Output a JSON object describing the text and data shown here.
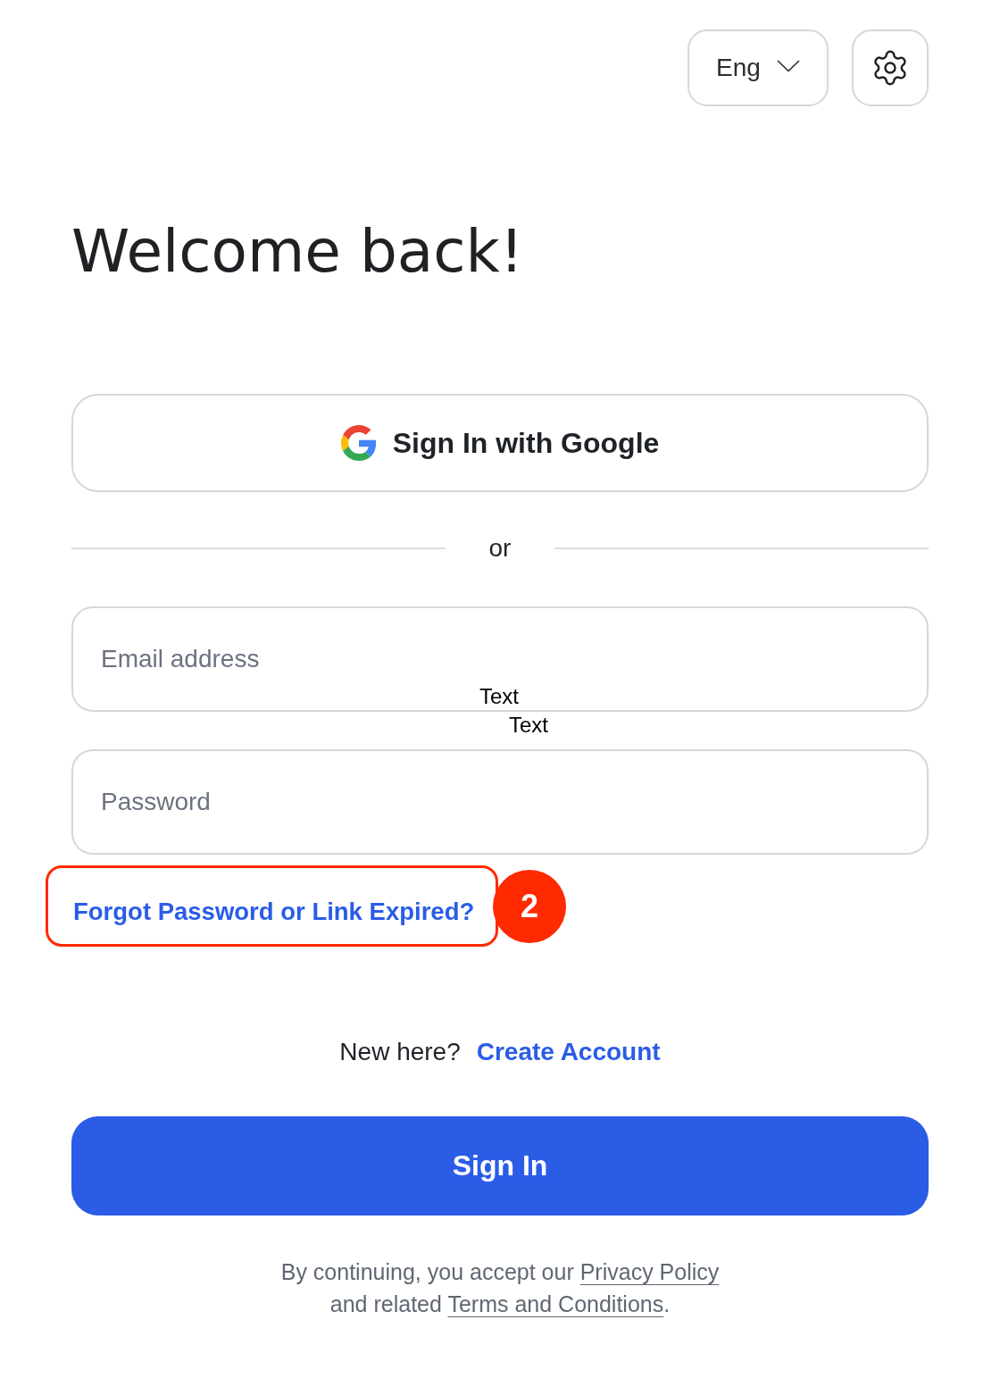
{
  "top_bar": {
    "language": {
      "label": "Eng"
    }
  },
  "title": "Welcome back!",
  "google_button": {
    "label": "Sign In with Google"
  },
  "divider": {
    "label": "or"
  },
  "email_field": {
    "placeholder": "Email address"
  },
  "stray_labels": [
    "Text",
    "Text"
  ],
  "password_field": {
    "placeholder": "Password"
  },
  "forgot_link": {
    "label": "Forgot Password or Link Expired?"
  },
  "annotation": {
    "badge": "2"
  },
  "signup": {
    "prompt": "New here?",
    "link": "Create Account"
  },
  "submit_button": {
    "label": "Sign In"
  },
  "legal": {
    "text_before": "By continuing, you accept our",
    "privacy_link": "Privacy Policy",
    "text_middle": "and related",
    "terms_link": "Terms and Conditions",
    "text_after": "."
  }
}
